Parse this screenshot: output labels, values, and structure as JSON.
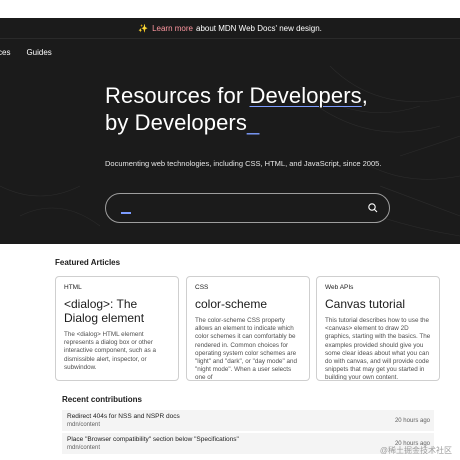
{
  "banner": {
    "icon": "sparkle-icon",
    "link_text": "Learn more",
    "text": "about MDN Web Docs' new design."
  },
  "nav": {
    "items": [
      {
        "label": "ces"
      },
      {
        "label": "Guides"
      }
    ]
  },
  "hero": {
    "title_line1_prefix": "Resources for ",
    "title_line1_highlight": "Developers",
    "title_line1_suffix": ",",
    "title_line2": "by Developers",
    "cursor": "_",
    "subtitle": "Documenting web technologies, including CSS, HTML, and JavaScript, since 2005.",
    "search_value": "",
    "search_icon": "search-icon"
  },
  "featured": {
    "heading": "Featured Articles",
    "cards": [
      {
        "tag": "HTML",
        "title": "<dialog>: The Dialog element",
        "description": "The <dialog> HTML element represents a dialog box or other interactive component, such as a dismissible alert, inspector, or subwindow."
      },
      {
        "tag": "CSS",
        "title": "color-scheme",
        "description": "The color-scheme CSS property allows an element to indicate which color schemes it can comfortably be rendered in. Common choices for operating system color schemes are \"light\" and \"dark\", or \"day mode\" and \"night mode\". When a user selects one of"
      },
      {
        "tag": "Web APIs",
        "title": "Canvas tutorial",
        "description": "This tutorial describes how to use the <canvas> element to draw 2D graphics, starting with the basics. The examples provided should give you some clear ideas about what you can do with canvas, and will provide code snippets that may get you started in building your own content."
      }
    ]
  },
  "recent": {
    "heading": "Recent contributions",
    "items": [
      {
        "title": "Redirect 404s for NSS and NSPR docs",
        "source": "mdn/content",
        "time": "20 hours ago"
      },
      {
        "title": "Place \"Browser compatibility\" section below \"Specifications\"",
        "source": "mdn/content",
        "time": "20 hours ago"
      }
    ]
  },
  "watermark": "@稀土掘金技术社区",
  "colors": {
    "dark_bg": "#1b1b1b",
    "accent_blue": "#7c9cff",
    "learn_more": "#ff97a0",
    "card_border": "#cfcfcf",
    "row_bg": "#f4f4f4"
  }
}
